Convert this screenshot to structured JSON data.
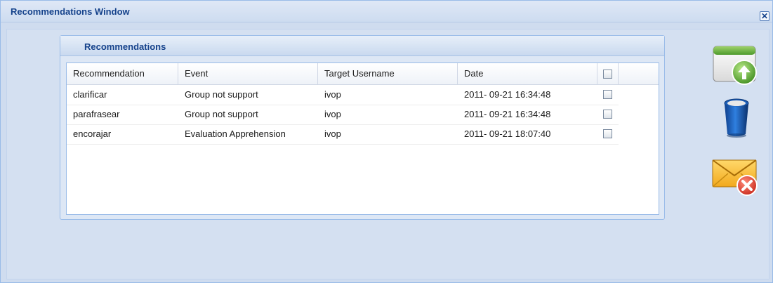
{
  "window": {
    "title": "Recommendations Window"
  },
  "panel": {
    "title": "Recommendations"
  },
  "grid": {
    "columns": [
      "Recommendation",
      "Event",
      "Target Username",
      "Date"
    ],
    "rows": [
      {
        "recommendation": "clarificar",
        "event": "Group not support",
        "target": "ivop",
        "date": "2011- 09-21 16:34:48",
        "checked": false
      },
      {
        "recommendation": "parafrasear",
        "event": "Group not support",
        "target": "ivop",
        "date": "2011- 09-21 16:34:48",
        "checked": false
      },
      {
        "recommendation": "encorajar",
        "event": "Evaluation Apprehension",
        "target": "ivop",
        "date": "2011- 09-21 18:07:40",
        "checked": false
      }
    ]
  },
  "actions": {
    "upload_icon": "upload-icon",
    "trash_icon": "trash-icon",
    "delete_mail_icon": "delete-mail-icon"
  }
}
